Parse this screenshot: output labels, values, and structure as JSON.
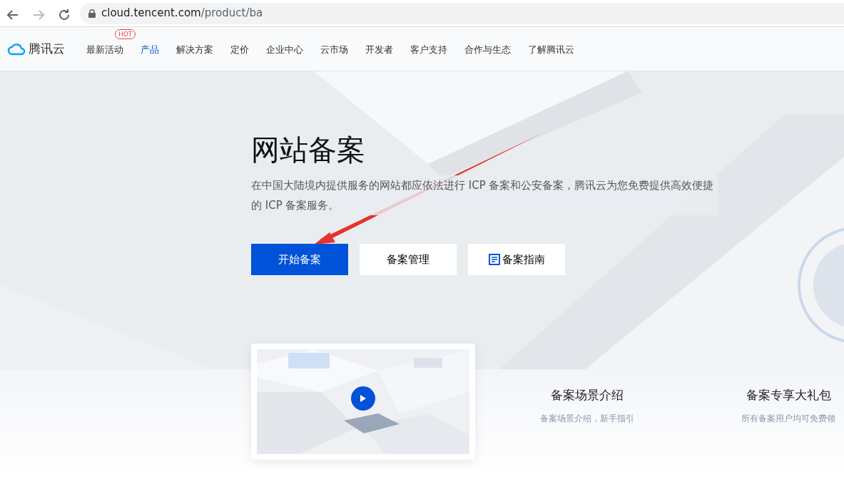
{
  "browser": {
    "back_disabled": false,
    "forward_disabled": true,
    "url_host": "cloud.tencent.com",
    "url_path": "/product/ba"
  },
  "nav": {
    "logo_text": "腾讯云",
    "items": [
      {
        "label": "最新活动",
        "selected": false,
        "badge": "HOT"
      },
      {
        "label": "产品",
        "selected": true
      },
      {
        "label": "解决方案",
        "selected": false
      },
      {
        "label": "定价",
        "selected": false
      },
      {
        "label": "企业中心",
        "selected": false
      },
      {
        "label": "云市场",
        "selected": false
      },
      {
        "label": "开发者",
        "selected": false
      },
      {
        "label": "客户支持",
        "selected": false
      },
      {
        "label": "合作与生态",
        "selected": false
      },
      {
        "label": "了解腾讯云",
        "selected": false
      }
    ]
  },
  "hero": {
    "title": "网站备案",
    "description": "在中国大陆境内提供服务的网站都应依法进行 ICP 备案和公安备案，腾讯云为您免费提供高效便捷的 ICP 备案服务。",
    "buttons": [
      {
        "label": "开始备案",
        "kind": "primary"
      },
      {
        "label": "备案管理",
        "kind": "secondary"
      },
      {
        "label": "备案指南",
        "kind": "guide"
      }
    ]
  },
  "features": [
    {
      "title": "备案场景介绍",
      "subtitle": "备案场景介绍，新手指引"
    },
    {
      "title": "备案专享大礼包",
      "subtitle": "所有备案用户均可免费领"
    }
  ]
}
